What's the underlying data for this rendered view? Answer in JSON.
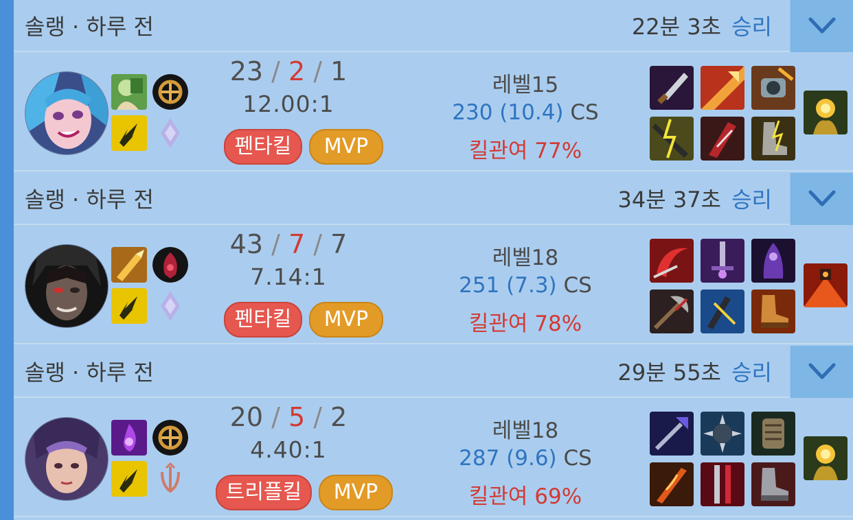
{
  "matches": [
    {
      "mode": "솔랭 · 하루 전",
      "duration": "22분 3초",
      "result": "승리",
      "champion_icon": "jinx-champion-portrait",
      "spells": [
        "ghost-spell-icon",
        "flash-spell-icon"
      ],
      "runes": [
        "lethal-tempo-rune-icon",
        "sorcery-secondary-rune-icon"
      ],
      "kills": "23",
      "deaths": "2",
      "assists": "1",
      "kda_ratio": "12.00:1",
      "multikill_badge": "펜타킬",
      "mvp_badge": "MVP",
      "level": "레벨15",
      "cs": "230 (10.4)",
      "cs_unit": "CS",
      "kill_participation": "킬관여 77%",
      "items": [
        "dagger-item-icon",
        "spear-item-icon",
        "cannon-item-icon",
        "lightning-blade-item-icon",
        "blade-item-icon",
        "greaves-item-icon"
      ],
      "trinket": "warding-totem-trinket-icon"
    },
    {
      "mode": "솔랭 · 하루 전",
      "duration": "34분 37초",
      "result": "승리",
      "champion_icon": "kayn-champion-portrait",
      "spells": [
        "smite-spell-icon",
        "flash-spell-icon"
      ],
      "runes": [
        "dark-harvest-rune-icon",
        "sorcery-secondary-rune-icon"
      ],
      "kills": "43",
      "deaths": "7",
      "assists": "7",
      "kda_ratio": "7.14:1",
      "multikill_badge": "펜타킬",
      "mvp_badge": "MVP",
      "level": "레벨18",
      "cs": "251 (7.3)",
      "cs_unit": "CS",
      "kill_participation": "킬관여 78%",
      "items": [
        "scythe-item-icon",
        "sword-item-icon",
        "shadow-item-icon",
        "axe-item-icon",
        "rune-blade-item-icon",
        "boots-item-icon"
      ],
      "trinket": "oracle-lens-trinket-icon"
    },
    {
      "mode": "솔랭 · 하루 전",
      "duration": "29분 55초",
      "result": "승리",
      "champion_icon": "irelia-champion-portrait",
      "spells": [
        "ignite-spell-icon",
        "flash-spell-icon"
      ],
      "runes": [
        "conqueror-rune-icon",
        "precision-secondary-rune-icon"
      ],
      "kills": "20",
      "deaths": "5",
      "assists": "2",
      "kda_ratio": "4.40:1",
      "multikill_badge": "트리플킬",
      "mvp_badge": "MVP",
      "level": "레벨18",
      "cs": "287 (9.6)",
      "cs_unit": "CS",
      "kill_participation": "킬관여 69%",
      "items": [
        "trident-item-icon",
        "spiked-item-icon",
        "gauntlet-item-icon",
        "flame-blade-item-icon",
        "crimson-blade-item-icon",
        "plated-boots-item-icon"
      ],
      "trinket": "warding-totem-trinket-icon"
    }
  ],
  "colors": {
    "panel": "#aacdef",
    "win_text": "#2f74c0",
    "deaths": "#d23a34",
    "multikill_badge": "#e5574f",
    "mvp_badge": "#e39b27"
  }
}
